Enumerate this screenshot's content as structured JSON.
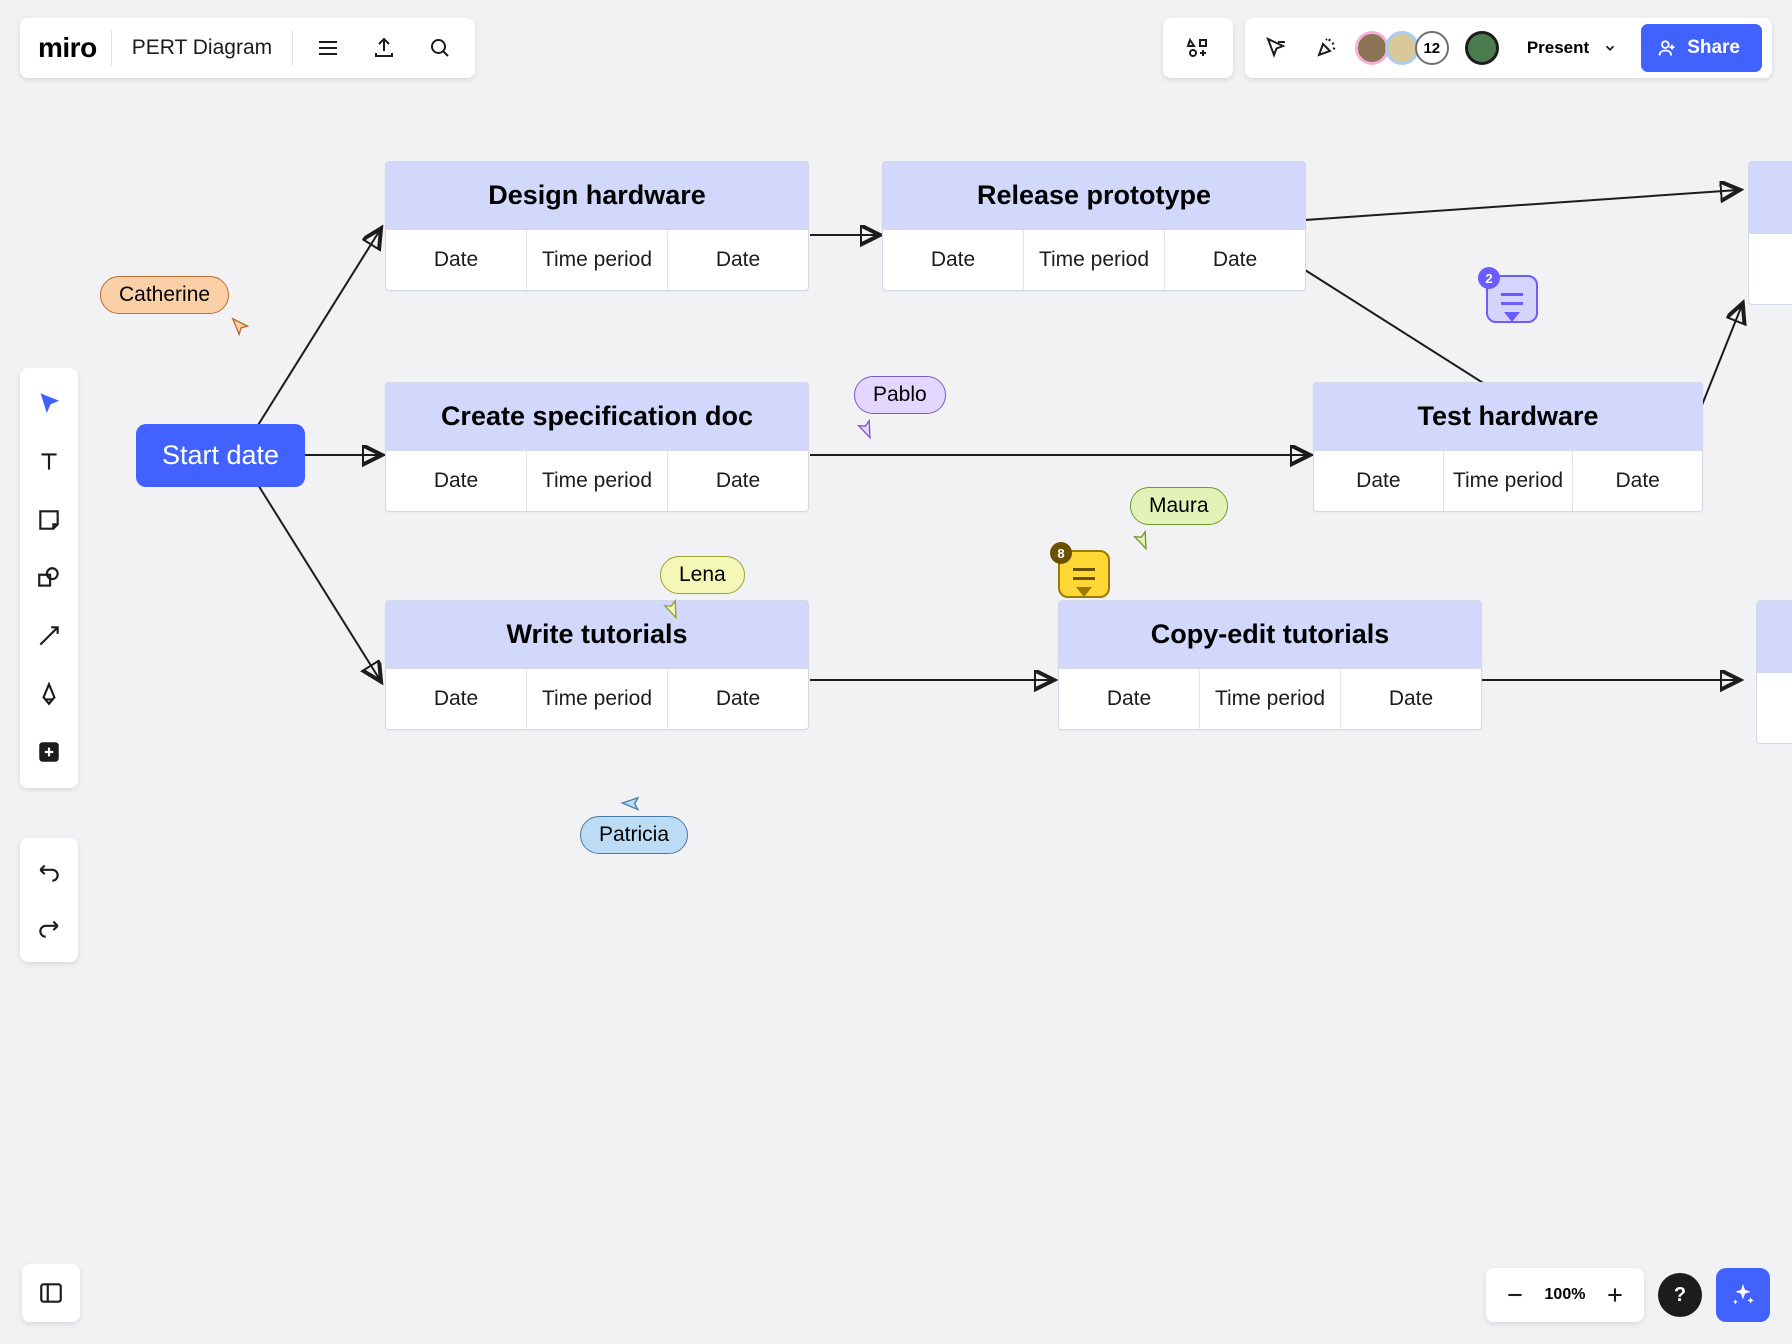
{
  "header": {
    "logo": "miro",
    "board_title": "PERT Diagram",
    "present_label": "Present",
    "share_label": "Share",
    "collab_count": "12"
  },
  "zoom": {
    "level": "100%"
  },
  "help_label": "?",
  "start_node": {
    "label": "Start date"
  },
  "col_labels": {
    "date": "Date",
    "period": "Time period"
  },
  "tasks": {
    "design": {
      "title": "Design hardware"
    },
    "spec": {
      "title": "Create specification doc"
    },
    "write": {
      "title": "Write tutorials"
    },
    "release": {
      "title": "Release prototype"
    },
    "test": {
      "title": "Test hardware"
    },
    "copyedit": {
      "title": "Copy-edit tutorials"
    }
  },
  "cursors": {
    "catherine": {
      "name": "Catherine",
      "color": "#fcd0a6",
      "border": "#b56f2e"
    },
    "pablo": {
      "name": "Pablo",
      "color": "#e3d6ff",
      "border": "#7a5cc8"
    },
    "lena": {
      "name": "Lena",
      "color": "#f4f7b8",
      "border": "#97a335"
    },
    "maura": {
      "name": "Maura",
      "color": "#e3f3b8",
      "border": "#6f9a2e"
    },
    "patricia": {
      "name": "Patricia",
      "color": "#bcdcf5",
      "border": "#4a7ca8"
    }
  },
  "comments": {
    "c1": {
      "count": "2"
    },
    "c2": {
      "count": "8"
    }
  }
}
